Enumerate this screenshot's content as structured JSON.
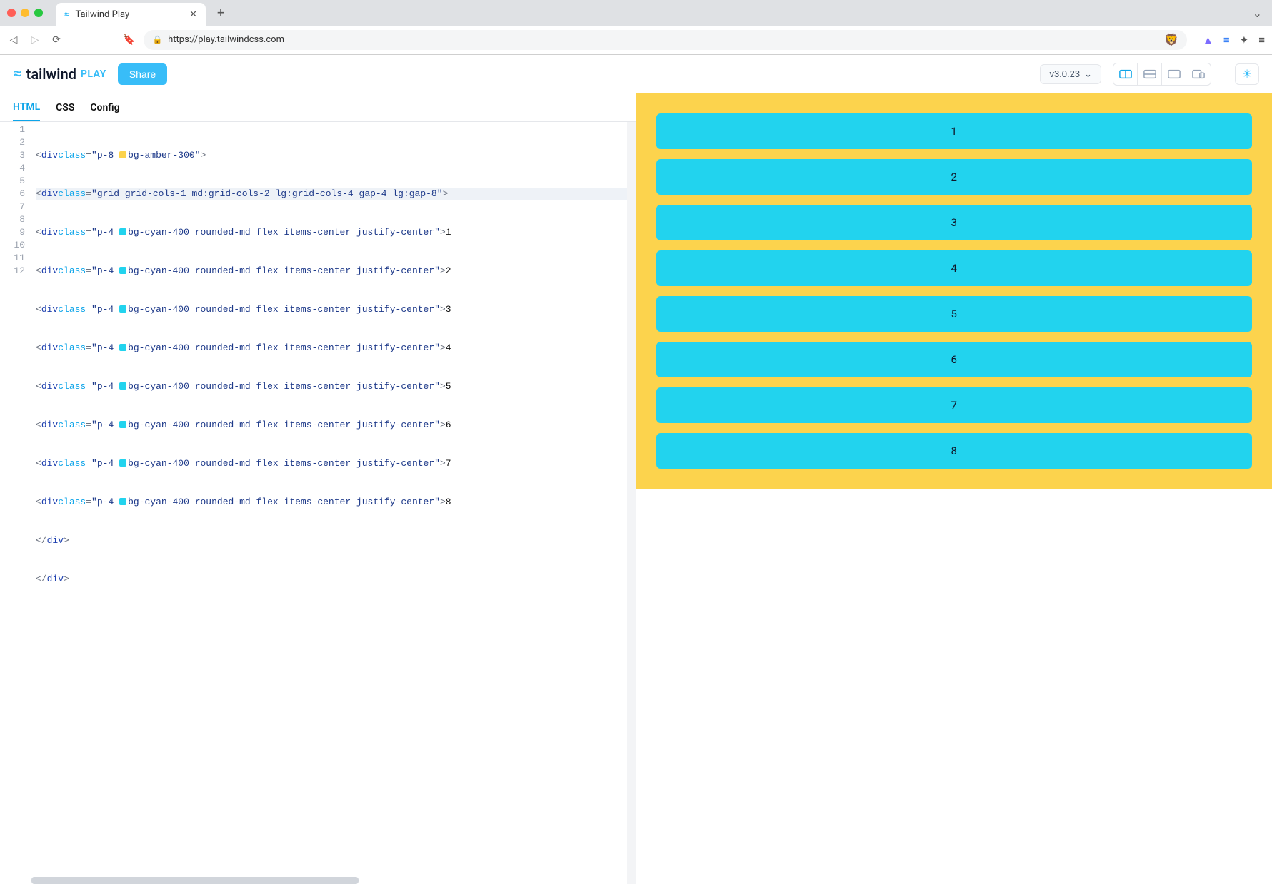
{
  "browser": {
    "tab_title": "Tailwind Play",
    "url": "https://play.tailwindcss.com"
  },
  "header": {
    "logo_text": "tailwind",
    "logo_play": "PLAY",
    "share_label": "Share",
    "version_label": "v3.0.23"
  },
  "editor": {
    "tabs": {
      "html": "HTML",
      "css": "CSS",
      "config": "Config"
    },
    "line_numbers": [
      "1",
      "2",
      "3",
      "4",
      "5",
      "6",
      "7",
      "8",
      "9",
      "10",
      "11",
      "12"
    ],
    "outer_class": "p-8 bg-amber-300",
    "grid_class": "grid grid-cols-1 md:grid-cols-2 lg:grid-cols-4 gap-4 lg:gap-8",
    "item_class": "p-4 bg-cyan-400 rounded-md flex items-center justify-center",
    "item_class_pre": "p-4 ",
    "item_class_post": "bg-cyan-400 rounded-md flex items-center justify-center",
    "outer_pre": "p-8 ",
    "outer_post": "bg-amber-300",
    "close_inner": "</div>",
    "close_outer": "</div>",
    "items_text": [
      "1",
      "2",
      "3",
      "4",
      "5",
      "6",
      "7",
      "8"
    ]
  },
  "preview": {
    "cells": [
      "1",
      "2",
      "3",
      "4",
      "5",
      "6",
      "7",
      "8"
    ]
  }
}
